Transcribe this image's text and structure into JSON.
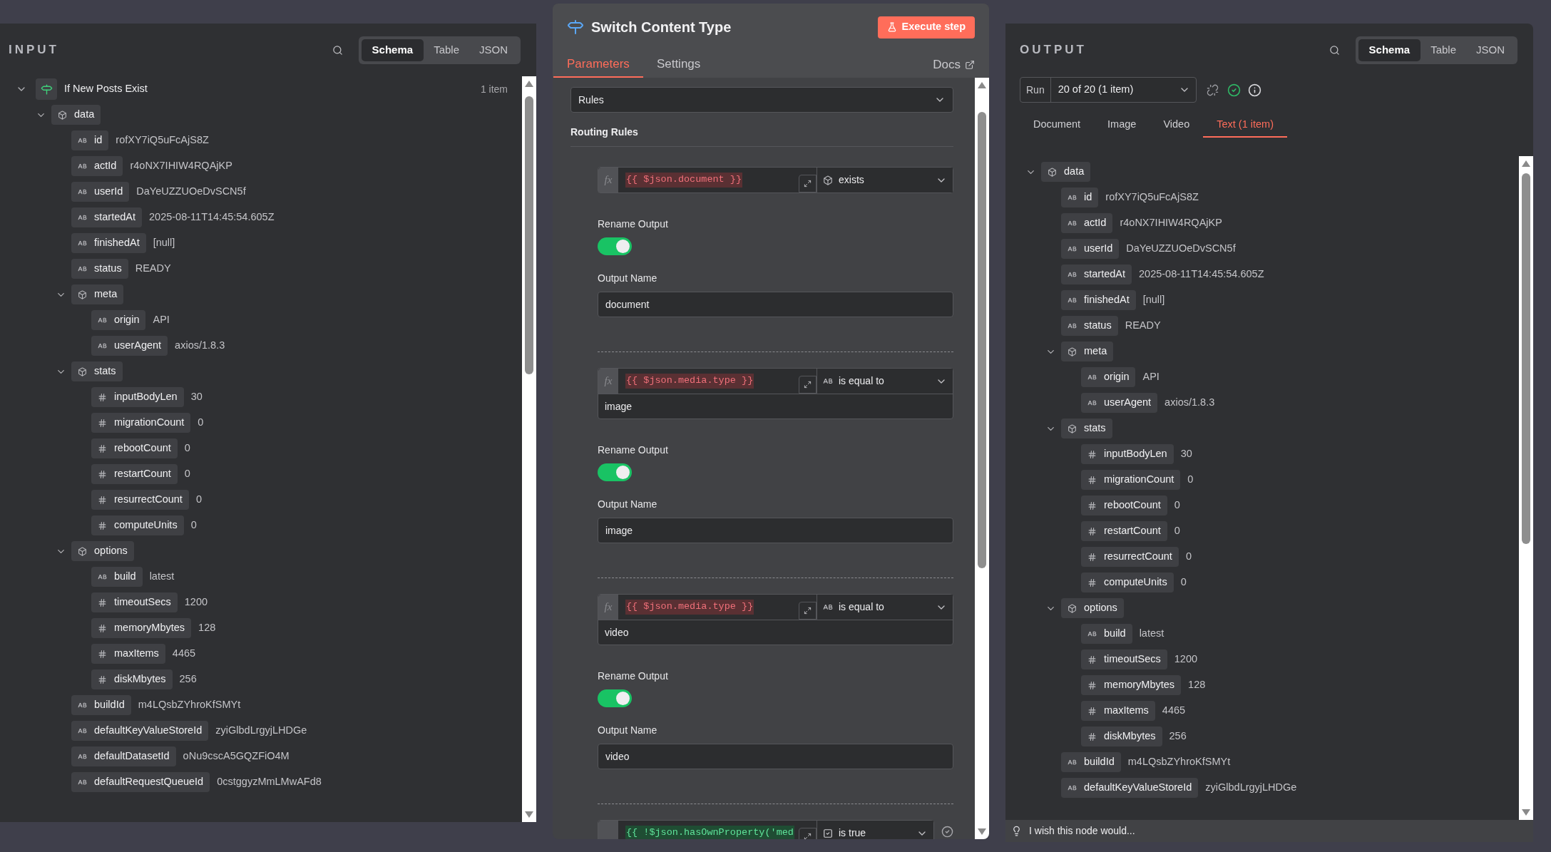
{
  "input": {
    "title": "INPUT",
    "view_tabs": [
      {
        "label": "Schema",
        "selected": true
      },
      {
        "label": "Table",
        "selected": false
      },
      {
        "label": "JSON",
        "selected": false
      }
    ],
    "node": {
      "name": "If New Posts Exist",
      "count": "1 item",
      "expanded": true
    },
    "tree": [
      {
        "kind": "object",
        "key": "data",
        "expanded": true,
        "children": [
          {
            "kind": "string",
            "key": "id",
            "value": "rofXY7iQ5uFcAjS8Z"
          },
          {
            "kind": "string",
            "key": "actId",
            "value": "r4oNX7IHIW4RQAjKP"
          },
          {
            "kind": "string",
            "key": "userId",
            "value": "DaYeUZZUOeDvSCN5f"
          },
          {
            "kind": "string",
            "key": "startedAt",
            "value": "2025-08-11T14:45:54.605Z"
          },
          {
            "kind": "string",
            "key": "finishedAt",
            "value": "[null]"
          },
          {
            "kind": "string",
            "key": "status",
            "value": "READY"
          },
          {
            "kind": "object",
            "key": "meta",
            "expanded": true,
            "children": [
              {
                "kind": "string",
                "key": "origin",
                "value": "API"
              },
              {
                "kind": "string",
                "key": "userAgent",
                "value": "axios/1.8.3"
              }
            ]
          },
          {
            "kind": "object",
            "key": "stats",
            "expanded": true,
            "children": [
              {
                "kind": "number",
                "key": "inputBodyLen",
                "value": "30"
              },
              {
                "kind": "number",
                "key": "migrationCount",
                "value": "0"
              },
              {
                "kind": "number",
                "key": "rebootCount",
                "value": "0"
              },
              {
                "kind": "number",
                "key": "restartCount",
                "value": "0"
              },
              {
                "kind": "number",
                "key": "resurrectCount",
                "value": "0"
              },
              {
                "kind": "number",
                "key": "computeUnits",
                "value": "0"
              }
            ]
          },
          {
            "kind": "object",
            "key": "options",
            "expanded": true,
            "children": [
              {
                "kind": "string",
                "key": "build",
                "value": "latest"
              },
              {
                "kind": "number",
                "key": "timeoutSecs",
                "value": "1200"
              },
              {
                "kind": "number",
                "key": "memoryMbytes",
                "value": "128"
              },
              {
                "kind": "number",
                "key": "maxItems",
                "value": "4465"
              },
              {
                "kind": "number",
                "key": "diskMbytes",
                "value": "256"
              }
            ]
          },
          {
            "kind": "string",
            "key": "buildId",
            "value": "m4LQsbZYhroKfSMYt"
          },
          {
            "kind": "string",
            "key": "defaultKeyValueStoreId",
            "value": "zyiGlbdLrgyjLHDGe"
          },
          {
            "kind": "string",
            "key": "defaultDatasetId",
            "value": "oNu9cscA5GQZFiO4M"
          },
          {
            "kind": "string",
            "key": "defaultRequestQueueId",
            "value": "0cstggyzMmLMwAFd8"
          }
        ]
      }
    ]
  },
  "editor": {
    "title": "Switch Content Type",
    "execute_button": "Execute step",
    "tabs": [
      {
        "label": "Parameters",
        "selected": true
      },
      {
        "label": "Settings",
        "selected": false
      }
    ],
    "docs": "Docs",
    "mode": "Rules",
    "section": "Routing Rules",
    "rules": [
      {
        "prefix": "fx",
        "expression": "{{ $json.document }}",
        "valid": false,
        "operator": {
          "kind": "object",
          "label": "exists"
        },
        "rename_label": "Rename Output",
        "rename_on": true,
        "output_name_label": "Output Name",
        "output_name": "document"
      },
      {
        "prefix": "fx",
        "expression": "{{ $json.media.type }}",
        "valid": false,
        "operator": {
          "kind": "string",
          "label": "is equal to"
        },
        "value": "image",
        "rename_label": "Rename Output",
        "rename_on": true,
        "output_name_label": "Output Name",
        "output_name": "image"
      },
      {
        "prefix": "fx",
        "expression": "{{ $json.media.type }}",
        "valid": false,
        "operator": {
          "kind": "string",
          "label": "is equal to"
        },
        "value": "video",
        "rename_label": "Rename Output",
        "rename_on": true,
        "output_name_label": "Output Name",
        "output_name": "video"
      },
      {
        "expression": "{{ !$json.hasOwnProperty('med",
        "valid": true,
        "operator": {
          "kind": "boolean",
          "label": "is true"
        }
      }
    ]
  },
  "output": {
    "title": "OUTPUT",
    "view_tabs": [
      {
        "label": "Schema",
        "selected": true
      },
      {
        "label": "Table",
        "selected": false
      },
      {
        "label": "JSON",
        "selected": false
      }
    ],
    "run_label": "Run",
    "run_value": "20 of 20 (1 item)",
    "branch_tabs": [
      {
        "label": "Document",
        "selected": false
      },
      {
        "label": "Image",
        "selected": false
      },
      {
        "label": "Video",
        "selected": false
      },
      {
        "label": "Text (1 item)",
        "selected": true
      }
    ],
    "tree": [
      {
        "kind": "object",
        "key": "data",
        "expanded": true,
        "children": [
          {
            "kind": "string",
            "key": "id",
            "value": "rofXY7iQ5uFcAjS8Z"
          },
          {
            "kind": "string",
            "key": "actId",
            "value": "r4oNX7IHIW4RQAjKP"
          },
          {
            "kind": "string",
            "key": "userId",
            "value": "DaYeUZZUOeDvSCN5f"
          },
          {
            "kind": "string",
            "key": "startedAt",
            "value": "2025-08-11T14:45:54.605Z"
          },
          {
            "kind": "string",
            "key": "finishedAt",
            "value": "[null]"
          },
          {
            "kind": "string",
            "key": "status",
            "value": "READY"
          },
          {
            "kind": "object",
            "key": "meta",
            "expanded": true,
            "children": [
              {
                "kind": "string",
                "key": "origin",
                "value": "API"
              },
              {
                "kind": "string",
                "key": "userAgent",
                "value": "axios/1.8.3"
              }
            ]
          },
          {
            "kind": "object",
            "key": "stats",
            "expanded": true,
            "children": [
              {
                "kind": "number",
                "key": "inputBodyLen",
                "value": "30"
              },
              {
                "kind": "number",
                "key": "migrationCount",
                "value": "0"
              },
              {
                "kind": "number",
                "key": "rebootCount",
                "value": "0"
              },
              {
                "kind": "number",
                "key": "restartCount",
                "value": "0"
              },
              {
                "kind": "number",
                "key": "resurrectCount",
                "value": "0"
              },
              {
                "kind": "number",
                "key": "computeUnits",
                "value": "0"
              }
            ]
          },
          {
            "kind": "object",
            "key": "options",
            "expanded": true,
            "children": [
              {
                "kind": "string",
                "key": "build",
                "value": "latest"
              },
              {
                "kind": "number",
                "key": "timeoutSecs",
                "value": "1200"
              },
              {
                "kind": "number",
                "key": "memoryMbytes",
                "value": "128"
              },
              {
                "kind": "number",
                "key": "maxItems",
                "value": "4465"
              },
              {
                "kind": "number",
                "key": "diskMbytes",
                "value": "256"
              }
            ]
          },
          {
            "kind": "string",
            "key": "buildId",
            "value": "m4LQsbZYhroKfSMYt"
          },
          {
            "kind": "string",
            "key": "defaultKeyValueStoreId",
            "value": "zyiGlbdLrgyjLHDGe"
          }
        ]
      }
    ],
    "feedback": "I wish this node would..."
  }
}
